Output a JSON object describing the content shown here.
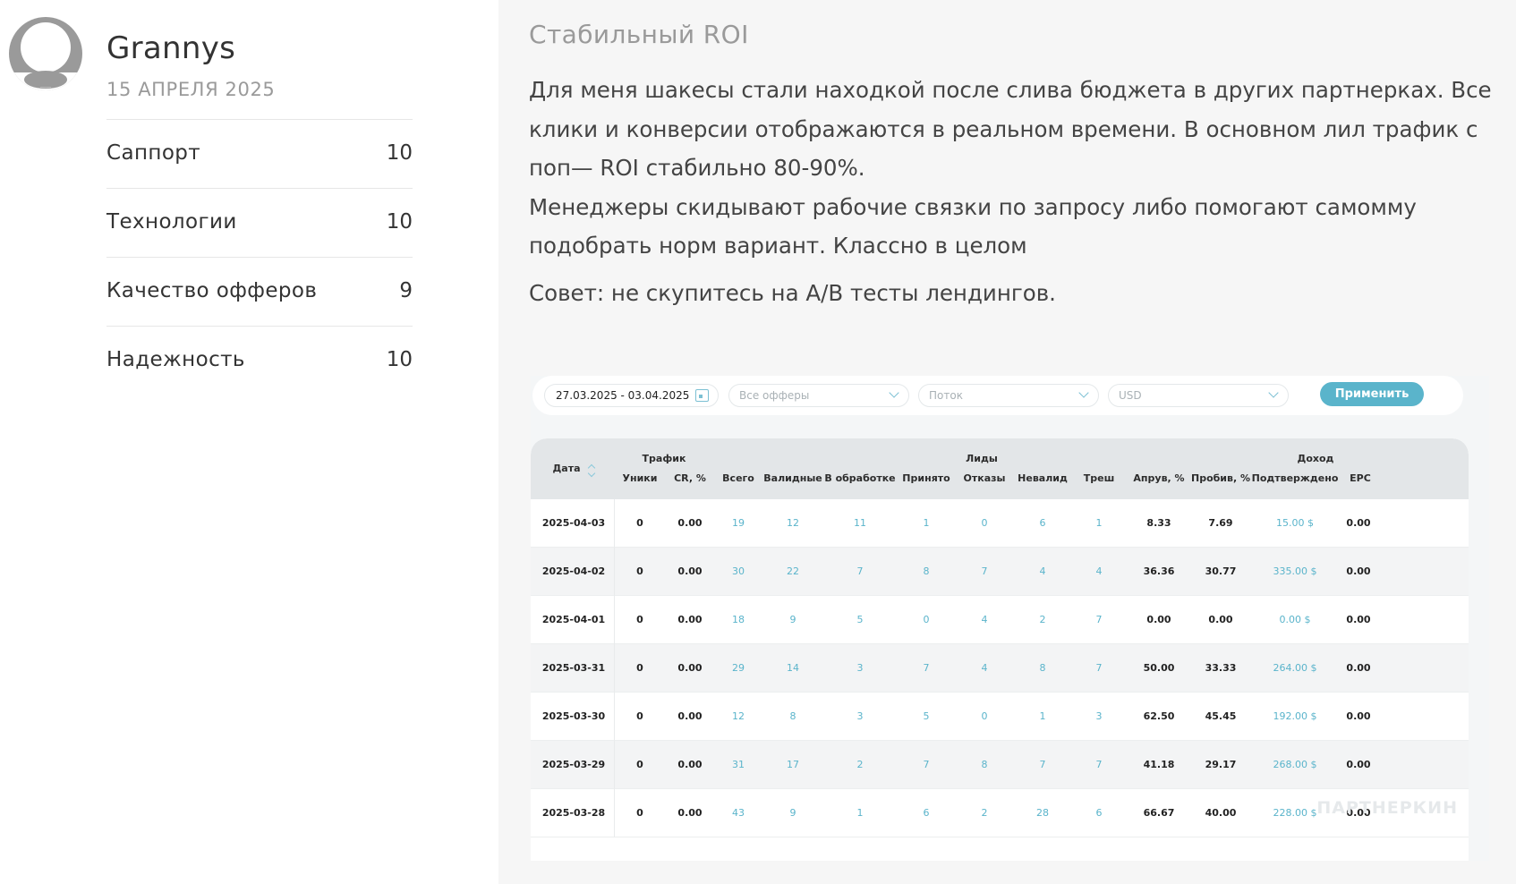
{
  "reviewer": {
    "name": "Grannys",
    "date": "15 АПРЕЛЯ 2025",
    "avatar_icon": "user-avatar-icon"
  },
  "ratings": [
    {
      "label": "Саппорт",
      "value": "10"
    },
    {
      "label": "Технологии",
      "value": "10"
    },
    {
      "label": "Качество офферов",
      "value": "9"
    },
    {
      "label": "Надежность",
      "value": "10"
    }
  ],
  "review": {
    "title": "Стабильный ROI",
    "body_line1": "Для меня шакесы стали находкой после слива бюджета в других партнерках. Все клики и конверсии отображаются в реальном времени. В основном лил трафик с поп— ROI стабильно 80-90%.",
    "body_line2": "Менеджеры скидывают рабочие связки по запросу либо помогают самомму подобрать норм вариант. Классно в целом",
    "advice": "Совет: не скупитесь на A/B тесты лендингов."
  },
  "stats_screenshot": {
    "filters": {
      "date_range": "27.03.2025 - 03.04.2025",
      "offers_placeholder": "Все офферы",
      "stream_placeholder": "Поток",
      "currency": "USD",
      "apply_label": "Применить"
    },
    "header": {
      "group_traffic": "Трафик",
      "group_leads": "Лиды",
      "group_income": "Доход",
      "date": "Дата",
      "uniques": "Уники",
      "cr": "CR, %",
      "total": "Всего",
      "valid": "Валидные",
      "processing": "В обработке",
      "accepted": "Принято",
      "rejected": "Отказы",
      "invalid": "Невалид",
      "trash": "Треш",
      "approve": "Апрув, %",
      "breakthrough": "Пробив, %",
      "confirmed": "Подтверждено",
      "epc": "EPC"
    },
    "rows": [
      {
        "date": "2025-04-03",
        "uniques": "0",
        "cr": "0.00",
        "total": "19",
        "valid": "12",
        "processing": "11",
        "accepted": "1",
        "rejected": "0",
        "invalid": "6",
        "trash": "1",
        "approve": "8.33",
        "breakthrough": "7.69",
        "confirmed": "15.00 $",
        "epc": "0.00"
      },
      {
        "date": "2025-04-02",
        "uniques": "0",
        "cr": "0.00",
        "total": "30",
        "valid": "22",
        "processing": "7",
        "accepted": "8",
        "rejected": "7",
        "invalid": "4",
        "trash": "4",
        "approve": "36.36",
        "breakthrough": "30.77",
        "confirmed": "335.00 $",
        "epc": "0.00"
      },
      {
        "date": "2025-04-01",
        "uniques": "0",
        "cr": "0.00",
        "total": "18",
        "valid": "9",
        "processing": "5",
        "accepted": "0",
        "rejected": "4",
        "invalid": "2",
        "trash": "7",
        "approve": "0.00",
        "breakthrough": "0.00",
        "confirmed": "0.00 $",
        "epc": "0.00"
      },
      {
        "date": "2025-03-31",
        "uniques": "0",
        "cr": "0.00",
        "total": "29",
        "valid": "14",
        "processing": "3",
        "accepted": "7",
        "rejected": "4",
        "invalid": "8",
        "trash": "7",
        "approve": "50.00",
        "breakthrough": "33.33",
        "confirmed": "264.00 $",
        "epc": "0.00"
      },
      {
        "date": "2025-03-30",
        "uniques": "0",
        "cr": "0.00",
        "total": "12",
        "valid": "8",
        "processing": "3",
        "accepted": "5",
        "rejected": "0",
        "invalid": "1",
        "trash": "3",
        "approve": "62.50",
        "breakthrough": "45.45",
        "confirmed": "192.00 $",
        "epc": "0.00"
      },
      {
        "date": "2025-03-29",
        "uniques": "0",
        "cr": "0.00",
        "total": "31",
        "valid": "17",
        "processing": "2",
        "accepted": "7",
        "rejected": "8",
        "invalid": "7",
        "trash": "7",
        "approve": "41.18",
        "breakthrough": "29.17",
        "confirmed": "268.00 $",
        "epc": "0.00"
      },
      {
        "date": "2025-03-28",
        "uniques": "0",
        "cr": "0.00",
        "total": "43",
        "valid": "9",
        "processing": "1",
        "accepted": "6",
        "rejected": "2",
        "invalid": "28",
        "trash": "6",
        "approve": "66.67",
        "breakthrough": "40.00",
        "confirmed": "228.00 $",
        "epc": "0.00"
      }
    ],
    "watermark": "ПАРТНЕРКИН"
  }
}
